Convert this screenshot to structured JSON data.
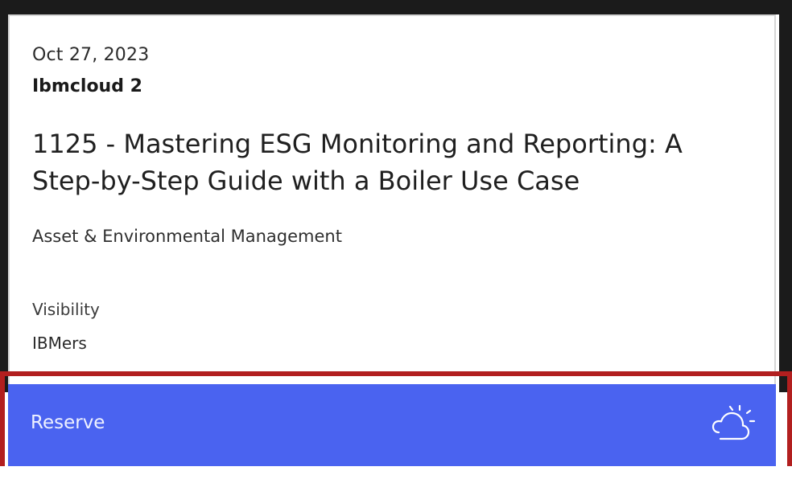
{
  "session_card": {
    "date": "Oct 27, 2023",
    "location": "Ibmcloud 2",
    "title": "1125 - Mastering ESG Monitoring and Reporting: A Step-by-Step Guide with a Boiler Use Case",
    "category": "Asset & Environmental Management",
    "visibility_label": "Visibility",
    "visibility_value": "IBMers",
    "reserve_label": "Reserve",
    "reserve_icon": "partly-cloudy-icon"
  },
  "colors": {
    "accent": "#4a63f0",
    "highlight_border": "#b21f1f",
    "card_border": "#d6d6d6"
  }
}
